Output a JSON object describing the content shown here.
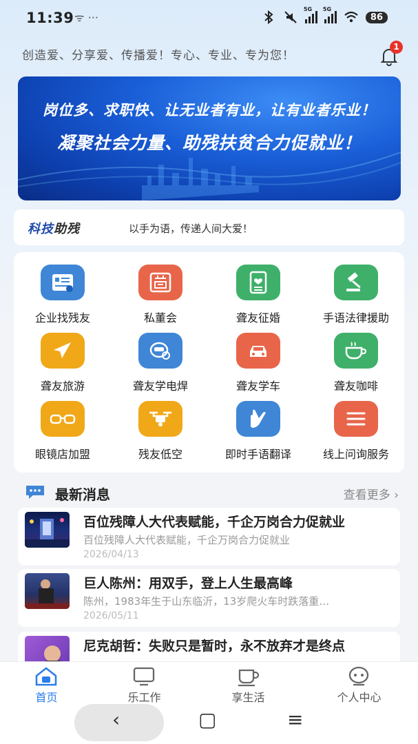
{
  "status_bar": {
    "time": "11:39",
    "left_icons": "ᯤ ···",
    "battery": "86"
  },
  "header": {
    "slogan": "创造爱、分享爱、传播爱！专心、专业、专为您！",
    "notification_count": "1"
  },
  "banner": {
    "line1": "岗位多、求职快、让无业者有业，让有业者乐业！",
    "line2": "凝聚社会力量、助残扶贫合力促就业！"
  },
  "tech_card": {
    "logo_part1": "科技",
    "logo_part2": "助残",
    "text": "以手为语，传递人间大爱！"
  },
  "services": [
    {
      "label": "企业找残友",
      "icon": "id-card-icon",
      "color": "#3f86d6"
    },
    {
      "label": "私董会",
      "icon": "council-seal-icon",
      "color": "#e8654a"
    },
    {
      "label": "聋友征婚",
      "icon": "heart-card-icon",
      "color": "#3fb06a"
    },
    {
      "label": "手语法律援助",
      "icon": "gavel-icon",
      "color": "#3fb06a"
    },
    {
      "label": "聋友旅游",
      "icon": "airplane-icon",
      "color": "#f0a818"
    },
    {
      "label": "聋友学电焊",
      "icon": "welding-mask-icon",
      "color": "#3f86d6"
    },
    {
      "label": "聋友学车",
      "icon": "car-icon",
      "color": "#e8654a"
    },
    {
      "label": "聋友咖啡",
      "icon": "coffee-cup-icon",
      "color": "#3fb06a"
    },
    {
      "label": "眼镜店加盟",
      "icon": "glasses-icon",
      "color": "#f0a818"
    },
    {
      "label": "残友低空",
      "icon": "drone-icon",
      "color": "#f0a818"
    },
    {
      "label": "即时手语翻译",
      "icon": "sign-hand-icon",
      "color": "#3f86d6"
    },
    {
      "label": "线上问询服务",
      "icon": "menu-lines-icon",
      "color": "#e8654a"
    }
  ],
  "news": {
    "title": "最新消息",
    "more": "查看更多 ›",
    "items": [
      {
        "title": "百位残障人大代表赋能，千企万岗合力促就业",
        "sub": "百位残障人大代表赋能，千企万岗合力促就业",
        "date": "2026/04/13"
      },
      {
        "title": "巨人陈州：用双手，登上人生最高峰",
        "sub": "陈州，1983年生于山东临沂，13岁爬火车时跌落重…",
        "date": "2026/05/11"
      },
      {
        "title": "尼克胡哲：失败只是暂时，永不放弃才是终点",
        "sub": "",
        "date": ""
      }
    ]
  },
  "bottom_nav": [
    {
      "label": "首页",
      "icon": "home-icon",
      "active": true
    },
    {
      "label": "乐工作",
      "icon": "monitor-icon",
      "active": false
    },
    {
      "label": "享生活",
      "icon": "cup-icon",
      "active": false
    },
    {
      "label": "个人中心",
      "icon": "chat-bot-icon",
      "active": false
    }
  ],
  "system_nav": {
    "back": "‹",
    "home": "▢",
    "menu": "≡"
  }
}
